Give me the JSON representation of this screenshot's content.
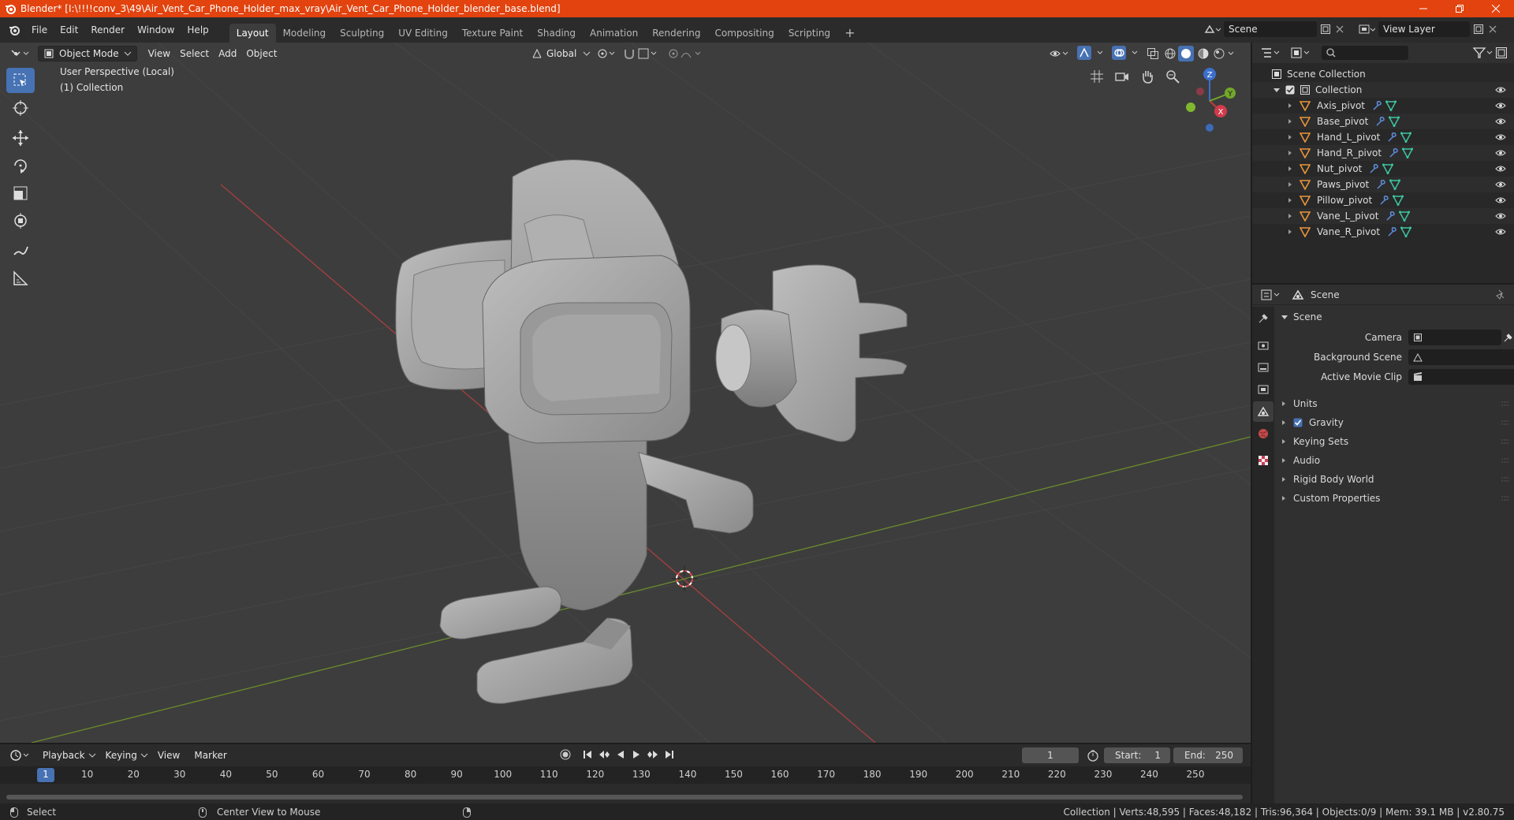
{
  "window": {
    "title": "Blender* [I:\\!!!!conv_3\\49\\Air_Vent_Car_Phone_Holder_max_vray\\Air_Vent_Car_Phone_Holder_blender_base.blend]"
  },
  "menu": [
    "File",
    "Edit",
    "Render",
    "Window",
    "Help"
  ],
  "workspaces": [
    "Layout",
    "Modeling",
    "Sculpting",
    "UV Editing",
    "Texture Paint",
    "Shading",
    "Animation",
    "Rendering",
    "Compositing",
    "Scripting"
  ],
  "active_workspace": "Layout",
  "scene_selector": "Scene",
  "view_layer": "View Layer",
  "viewport": {
    "mode": "Object Mode",
    "menus": [
      "View",
      "Select",
      "Add",
      "Object"
    ],
    "transform_orientation": "Global",
    "perspective_label": "User Perspective (Local)",
    "collection_label": "(1) Collection",
    "gizmo": {
      "z": "Z",
      "y": "Y",
      "x": "X"
    }
  },
  "outliner": {
    "root": "Scene Collection",
    "collection": "Collection",
    "objects": [
      "Axis_pivot",
      "Base_pivot",
      "Hand_L_pivot",
      "Hand_R_pivot",
      "Nut_pivot",
      "Paws_pivot",
      "Pillow_pivot",
      "Vane_L_pivot",
      "Vane_R_pivot"
    ]
  },
  "properties": {
    "header": "Scene",
    "panel": "Scene",
    "fields": {
      "camera": "Camera",
      "background_scene": "Background Scene",
      "active_movie_clip": "Active Movie Clip"
    },
    "sections": [
      "Units",
      "Gravity",
      "Keying Sets",
      "Audio",
      "Rigid Body World",
      "Custom Properties"
    ],
    "gravity_checked": true
  },
  "timeline": {
    "menus": [
      "Playback",
      "Keying",
      "View",
      "Marker"
    ],
    "current_frame": "1",
    "start_label": "Start:",
    "start": "1",
    "end_label": "End:",
    "end": "250",
    "ticks": [
      "1",
      "10",
      "20",
      "30",
      "40",
      "50",
      "60",
      "70",
      "80",
      "90",
      "100",
      "110",
      "120",
      "130",
      "140",
      "150",
      "160",
      "170",
      "180",
      "190",
      "200",
      "210",
      "220",
      "230",
      "240",
      "250"
    ]
  },
  "statusbar": {
    "left": "Select",
    "middle": "Center View to Mouse",
    "stats": "Collection | Verts:48,595 | Faces:48,182 | Tris:96,364 | Objects:0/9 | Mem: 39.1 MB | v2.80.75"
  }
}
